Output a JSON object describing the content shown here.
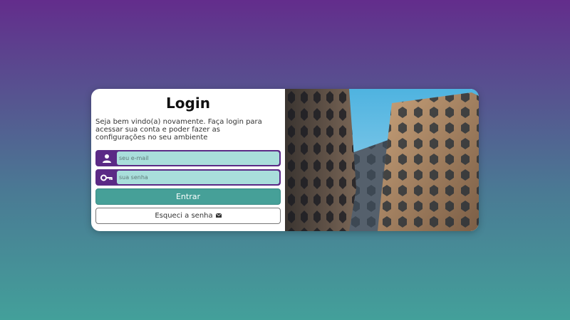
{
  "login": {
    "title": "Login",
    "description": "Seja bem vindo(a) novamente. Faça login para acessar sua conta e poder fazer as configurações no seu ambiente",
    "email_placeholder": "seu e-mail",
    "password_placeholder": "sua senha",
    "submit_label": "Entrar",
    "forgot_label": "Esqueci a senha",
    "icons": {
      "user": "user-icon",
      "key": "key-icon",
      "mail": "envelope-icon"
    }
  },
  "colors": {
    "accent_purple": "#5b2a86",
    "input_bg": "#a9dedb",
    "button_teal": "#46a098"
  }
}
